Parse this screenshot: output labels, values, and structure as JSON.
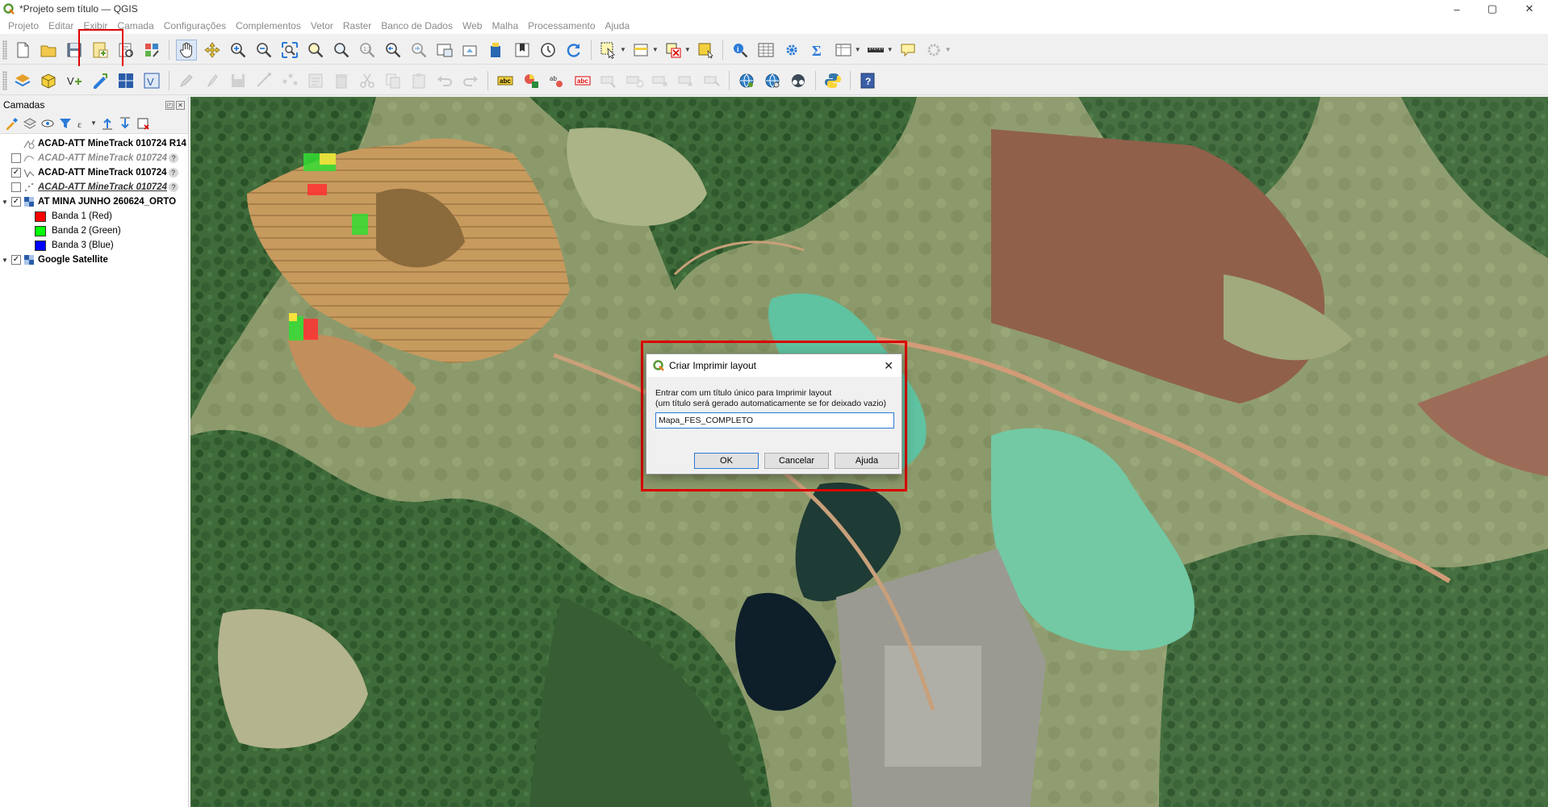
{
  "window": {
    "title": "*Projeto sem título — QGIS",
    "minimize": "–",
    "maximize": "▢",
    "close": "✕"
  },
  "menu": [
    "Projeto",
    "Editar",
    "Exibir",
    "Camada",
    "Configurações",
    "Complementos",
    "Vetor",
    "Raster",
    "Banco de Dados",
    "Web",
    "Malha",
    "Processamento",
    "Ajuda"
  ],
  "toolbar1": {
    "icons": [
      "new-project-icon",
      "open-project-icon",
      "save-project-icon",
      "new-print-layout-icon",
      "layout-manager-icon",
      "style-manager-icon",
      "pan-icon",
      "pan-to-selection-icon",
      "zoom-in-icon",
      "zoom-out-icon",
      "zoom-full-icon",
      "zoom-to-selection-icon",
      "zoom-to-layer-icon",
      "zoom-native-icon",
      "zoom-last-icon",
      "zoom-next-icon",
      "new-map-view-icon",
      "new-3d-view-icon",
      "temporal-controller-icon",
      "bookmark-icon",
      "show-bookmarks-icon",
      "refresh-icon",
      "select-features-icon",
      "select-by-value-icon",
      "deselect-icon",
      "select-location-icon",
      "identify-icon",
      "attribute-table-icon",
      "settings-gear-icon",
      "statistics-sum-icon",
      "field-calculator-icon",
      "measure-icon",
      "map-tips-icon",
      "annotation-icon"
    ]
  },
  "toolbar2": {
    "icons": [
      "data-source-manager-icon",
      "new-geopackage-icon",
      "new-shapefile-icon",
      "new-spatialite-icon",
      "new-virtual-layer-icon",
      "digitize-pencil-icon",
      "edit-pencil-icon",
      "save-edits-icon",
      "add-feature-icon",
      "vertex-tool-icon",
      "modify-attributes-icon",
      "delete-selected-icon",
      "cut-features-icon",
      "copy-features-icon",
      "paste-features-icon",
      "undo-icon",
      "redo-icon",
      "label-abc-icon",
      "label-diagram-icon",
      "label-pin-icon",
      "label-abc-red-icon",
      "move-label-icon",
      "rotate-label-icon",
      "change-label-icon",
      "show-hide-labels-icon",
      "label-toolbar-icon",
      "osm-globe-icon",
      "web-globe-icon",
      "quickmapservices-icon",
      "python-console-icon",
      "help-icon"
    ]
  },
  "panel": {
    "title": "Camadas",
    "layers": [
      {
        "label": "ACAD-ATT MineTrack 010724 R14",
        "checked": null,
        "style": "bold",
        "icon": "line-layer-icon",
        "q": ""
      },
      {
        "label": "ACAD-ATT MineTrack 010724",
        "checked": false,
        "style": "italic",
        "icon": "line-layer-icon",
        "q": "?"
      },
      {
        "label": "ACAD-ATT MineTrack 010724",
        "checked": true,
        "style": "bold",
        "icon": "line-layer-icon",
        "q": "?"
      },
      {
        "label": "ACAD-ATT MineTrack 010724",
        "checked": false,
        "style": "italic-underline",
        "icon": "point-layer-icon",
        "q": "?"
      },
      {
        "label": "AT MINA JUNHO 260624_ORTO",
        "checked": true,
        "style": "bold",
        "icon": "raster-layer-icon",
        "q": "",
        "expanded": true
      },
      {
        "label": "Banda 1 (Red)",
        "band": true,
        "color": "#ff0000"
      },
      {
        "label": "Banda 2 (Green)",
        "band": true,
        "color": "#00ff00"
      },
      {
        "label": "Banda 3 (Blue)",
        "band": true,
        "color": "#0000ff"
      },
      {
        "label": "Google Satellite",
        "checked": true,
        "style": "bold",
        "icon": "raster-layer-icon",
        "q": "",
        "expanded": true
      }
    ]
  },
  "dialog": {
    "title": "Criar Imprimir layout",
    "message_line1": "Entrar com um título único para Imprimir layout",
    "message_line2": "(um título será gerado automaticamente se for deixado vazio)",
    "input_value": "Mapa_FES_COMPLETO",
    "ok": "OK",
    "cancel": "Cancelar",
    "help": "Ajuda"
  },
  "colors": {
    "highlight": "#e00000",
    "input_focus": "#2b79d8"
  }
}
